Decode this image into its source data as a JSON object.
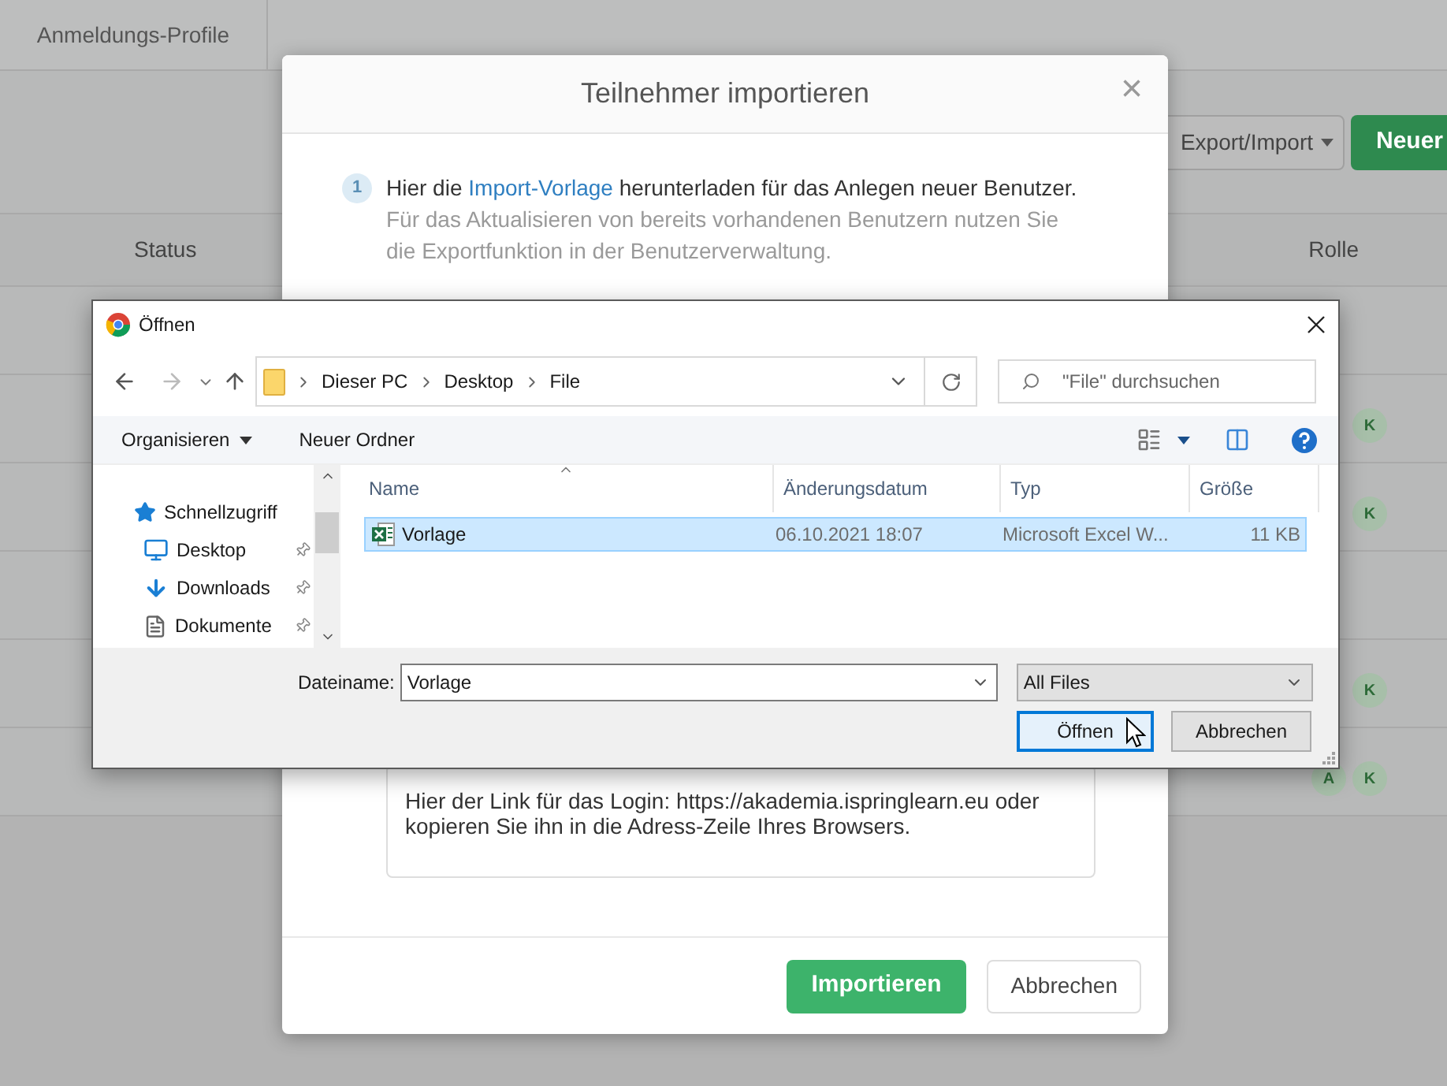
{
  "background": {
    "tab": "Anmeldungs-Profile",
    "toolbar": {
      "export_button": "Export/Import",
      "new_button": "Neuer"
    },
    "table": {
      "columns": [
        "Status",
        "Rolle"
      ],
      "rows": [
        {},
        {
          "roles": [
            "K"
          ]
        },
        {
          "roles": [
            "K"
          ]
        },
        {},
        {
          "roles": [
            "K"
          ]
        },
        {
          "roles": [
            "A",
            "K"
          ]
        }
      ]
    }
  },
  "import_dialog": {
    "title": "Teilnehmer importieren",
    "close": "×",
    "step": {
      "number": "1",
      "text_before": "Hier die ",
      "link": "Import-Vorlage",
      "text_after": " herunterladen für das Anlegen neuer Benutzer.",
      "note": "Für das Aktualisieren von bereits vorhandenen Benutzern nutzen Sie die Exportfunktion in der Benutzerverwaltung."
    },
    "login_text": "Hier der Link für das Login: https://akademia.ispringlearn.eu oder kopieren Sie ihn in die Adress-Zeile Ihres Browsers.",
    "buttons": [
      {
        "label": "Importieren",
        "kind": "primary"
      },
      {
        "label": "Abbrechen",
        "kind": "secondary"
      }
    ]
  },
  "file_dialog": {
    "title": "Öffnen",
    "path": [
      "Dieser PC",
      "Desktop",
      "File"
    ],
    "search": {
      "placeholder": "\"File\" durchsuchen"
    },
    "toolbar": [
      {
        "label": "Organisieren",
        "kind": "menu"
      },
      {
        "label": "Neuer Ordner",
        "kind": "plain"
      }
    ],
    "nav": [
      {
        "label": "Schnellzugriff",
        "kind": "star",
        "pinned": false
      },
      {
        "label": "Desktop",
        "kind": "desktop",
        "pinned": true
      },
      {
        "label": "Downloads",
        "kind": "download",
        "pinned": true
      },
      {
        "label": "Dokumente",
        "kind": "document",
        "pinned": true
      }
    ],
    "columns": [
      "Name",
      "Änderungsdatum",
      "Typ",
      "Größe"
    ],
    "files": [
      {
        "name": "Vorlage",
        "date": "06.10.2021 18:07",
        "type": "Microsoft Excel W...",
        "size": "11 KB",
        "selected": true
      }
    ],
    "filename_label": "Dateiname:",
    "filename": "Vorlage",
    "filter": "All Files",
    "buttons": [
      {
        "label": "Öffnen",
        "focused": true
      },
      {
        "label": "Abbrechen",
        "focused": false
      }
    ]
  }
}
